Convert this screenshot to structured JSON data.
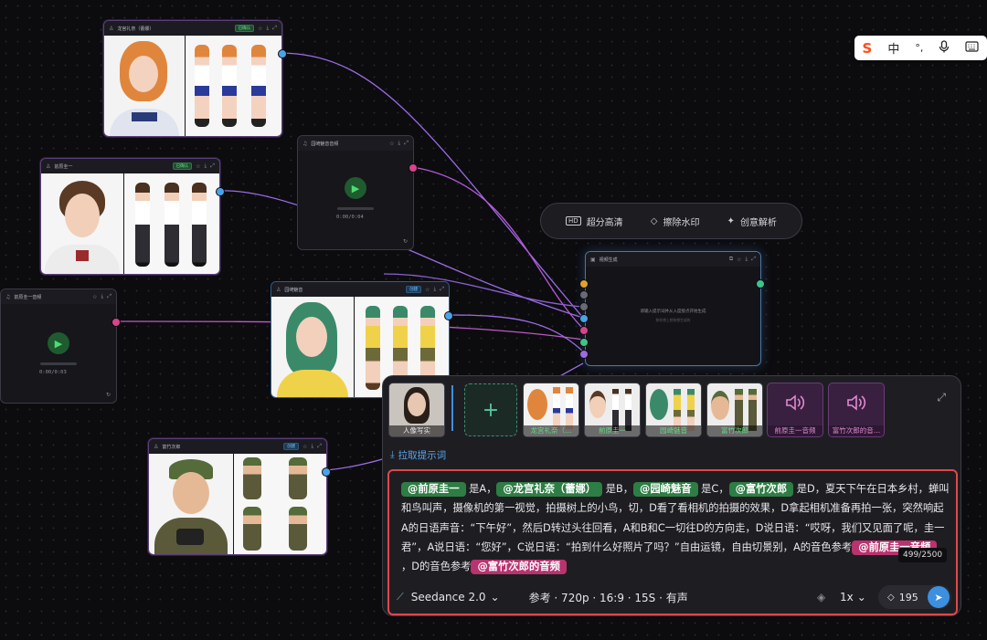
{
  "ime": {
    "logo": "S",
    "mode": "中",
    "punct": "°,",
    "mic": "mic-icon",
    "keyboard": "keyboard-icon"
  },
  "nodes": {
    "long_gong": {
      "title": "龙宫礼奈（蕾娜）",
      "badge": "已确认"
    },
    "qian_yuan": {
      "title": "前原圭一",
      "badge": "已确认"
    },
    "yuan_audio": {
      "title": "园崎魅音音频",
      "time": "0:00/0:04"
    },
    "qian_audio": {
      "title": "前原圭一音频",
      "time": "0:00/0:03"
    },
    "yuan_qi": {
      "title": "园崎魅音",
      "badge": "创建"
    },
    "fu_zhu": {
      "title": "富竹次郎",
      "badge": "创建"
    },
    "video_gen": {
      "title": "视频生成",
      "hint1": "请输入提示词并从入度接点开始生成",
      "hint2": "和你想上想你想生成的"
    }
  },
  "toolbar": {
    "items": [
      {
        "label": "超分高清",
        "icon": "hd-icon"
      },
      {
        "label": "擦除水印",
        "icon": "eraser-icon"
      },
      {
        "label": "创意解析",
        "icon": "sparkle-icon"
      }
    ]
  },
  "panel": {
    "thumbs": [
      {
        "label": "人像写实",
        "kind": "image"
      },
      {
        "label": "龙宫礼奈（…",
        "kind": "image"
      },
      {
        "label": "前原圭一",
        "kind": "image"
      },
      {
        "label": "园崎魅音",
        "kind": "image"
      },
      {
        "label": "富竹次郎",
        "kind": "image"
      },
      {
        "label": "前原圭一音频",
        "kind": "audio"
      },
      {
        "label": "富竹次郎的音…",
        "kind": "audio"
      }
    ],
    "pull_prompt": "拉取提示词",
    "prompt_segments": [
      {
        "t": "@前原圭一",
        "tag": "g"
      },
      {
        "t": " 是A，"
      },
      {
        "t": "@龙宫礼奈（蕾娜）",
        "tag": "g"
      },
      {
        "t": " 是B，"
      },
      {
        "t": "@园崎魅音",
        "tag": "g"
      },
      {
        "t": " 是C，"
      },
      {
        "t": "@富竹次郎",
        "tag": "g"
      },
      {
        "t": " 是D，夏天下午在日本乡村，蝉叫和鸟叫声，摄像机的第一视觉，拍摄树上的小鸟，切，D看了看相机的拍摄的效果，D拿起相机准备再拍一张，突然响起A的日语声音：“下午好”，然后D转过头往回看，A和B和C一切往D的方向走，D说日语：“哎呀，我们又见面了呢，圭一君”，A说日语：“您好”，C说日语：“拍到什么好照片了吗？”自由运镜，自由切景别，A的音色参考"
      },
      {
        "t": "@前原圭一音频",
        "tag": "p"
      },
      {
        "t": " ，D的音色参考"
      },
      {
        "t": "@富竹次郎的音频",
        "tag": "p"
      }
    ],
    "counter": "499/2500",
    "model": "Seedance 2.0",
    "params": "参考 · 720p · 16:9 · 15S · 有声",
    "speed": "1x",
    "credits": "195"
  }
}
